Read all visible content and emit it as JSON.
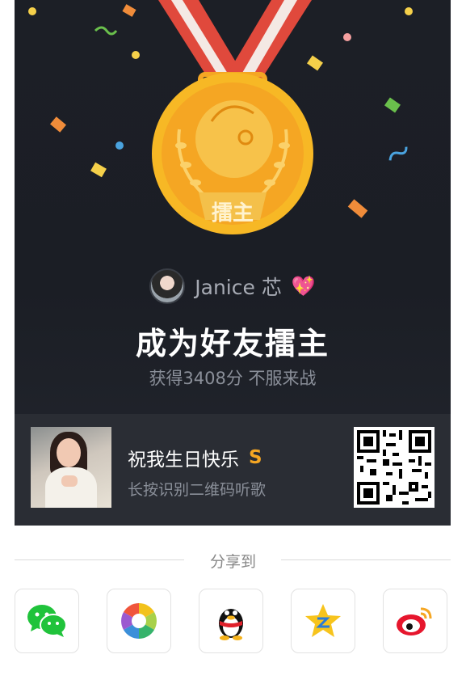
{
  "medal": {
    "label": "擂主"
  },
  "user": {
    "name": "Janice 芯",
    "emoji": "💖"
  },
  "achievement": {
    "title": "成为好友擂主",
    "subtitle": "获得3408分 不服来战"
  },
  "song": {
    "title": "祝我生日快乐",
    "badge": "S",
    "hint": "长按识别二维码听歌"
  },
  "share": {
    "label": "分享到",
    "targets": [
      {
        "name": "wechat",
        "icon": "wechat-icon"
      },
      {
        "name": "moments",
        "icon": "moments-icon"
      },
      {
        "name": "qq",
        "icon": "qq-penguin-icon"
      },
      {
        "name": "qzone",
        "icon": "qzone-star-icon"
      },
      {
        "name": "weibo",
        "icon": "weibo-icon"
      }
    ]
  },
  "colors": {
    "background": "#1c1f26",
    "gold": "#f5a623",
    "ribbon_red": "#e0493c",
    "ribbon_white": "#f4e9e4"
  }
}
